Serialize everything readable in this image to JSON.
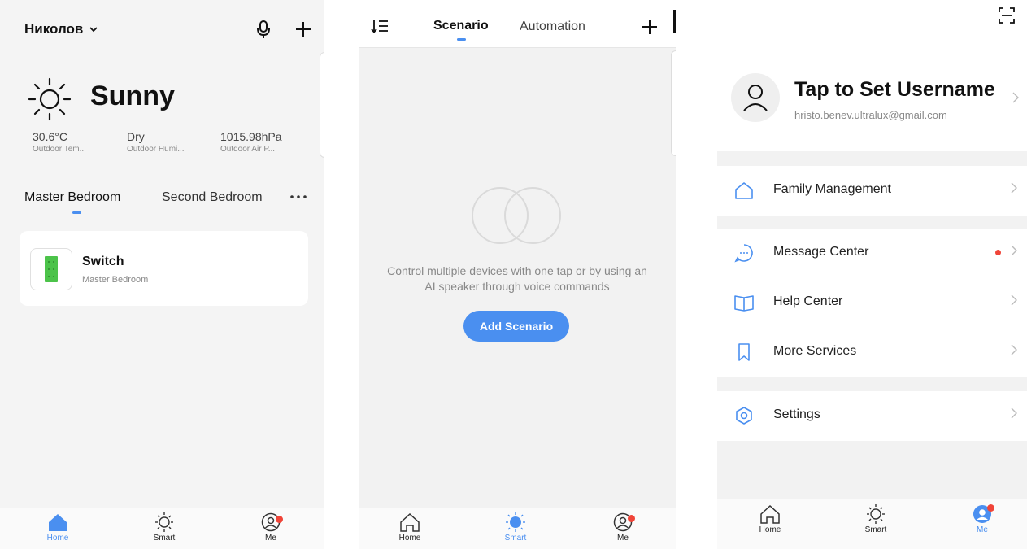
{
  "home": {
    "family_name": "Николов",
    "weather": {
      "condition": "Sunny",
      "metrics": [
        {
          "value": "30.6°C",
          "label": "Outdoor Tem..."
        },
        {
          "value": "Dry",
          "label": "Outdoor Humi..."
        },
        {
          "value": "1015.98hPa",
          "label": "Outdoor Air P..."
        }
      ]
    },
    "rooms": [
      "Master Bedroom",
      "Second Bedroom"
    ],
    "device": {
      "name": "Switch",
      "room": "Master Bedroom"
    },
    "tabs": {
      "home": "Home",
      "smart": "Smart",
      "me": "Me"
    }
  },
  "smart": {
    "tabs": {
      "scenario": "Scenario",
      "automation": "Automation"
    },
    "empty_text_line1": "Control multiple devices with one tap or by using an",
    "empty_text_line2": "AI speaker through voice commands",
    "add_button": "Add Scenario",
    "nav": {
      "home": "Home",
      "smart": "Smart",
      "me": "Me"
    }
  },
  "me": {
    "username": "Tap to Set Username",
    "email": "hristo.benev.ultralux@gmail.com",
    "menu": {
      "family": "Family Management",
      "messages": "Message Center",
      "help": "Help Center",
      "services": "More Services",
      "settings": "Settings"
    },
    "nav": {
      "home": "Home",
      "smart": "Smart",
      "me": "Me"
    }
  },
  "colors": {
    "accent": "#4a8ff0",
    "notification": "#f04438",
    "device_green": "#4cc34a"
  }
}
